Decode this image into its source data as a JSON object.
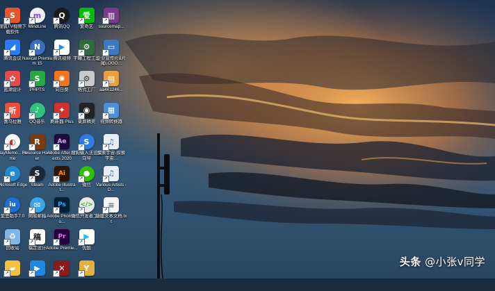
{
  "watermark": {
    "platform": "头条",
    "author": "@小张v同学"
  },
  "desktop_icons": [
    {
      "label": "搜狐TV视频下载软件",
      "icon": "fox-icon",
      "color": "#e8552a",
      "glyph": "S",
      "round": false
    },
    {
      "label": "MindLine",
      "icon": "mindline-icon",
      "color": "#f0f0f0",
      "glyph": "m",
      "round": true,
      "fg": "#8c4bd1"
    },
    {
      "label": "腾讯QQ",
      "icon": "qq-penguin-icon",
      "color": "#1a1a1a",
      "glyph": "Q",
      "round": true
    },
    {
      "label": "爱奇艺",
      "icon": "iqiyi-icon",
      "color": "#00be06",
      "glyph": "爱",
      "round": false
    },
    {
      "label": "sourcemap...",
      "icon": "winrar-icon",
      "color": "#7b3b8c",
      "glyph": "▥",
      "round": false
    },
    {
      "label": "腾讯会议",
      "icon": "tencent-meeting-icon",
      "color": "#2a7cf6",
      "glyph": "◢",
      "round": false
    },
    {
      "label": "Navicat Premium 15",
      "icon": "navicat-icon",
      "color": "#3a6ebf",
      "glyph": "N",
      "round": true
    },
    {
      "label": "腾讯视频",
      "icon": "tencent-video-icon",
      "color": "#ffffff",
      "glyph": "▶",
      "round": false,
      "fg": "#1f8ff0"
    },
    {
      "label": "宇瞳工程工具",
      "icon": "tool-icon",
      "color": "#2f6b3e",
      "glyph": "⚙",
      "round": false
    },
    {
      "label": "企业宣传片&片尾LOGO...",
      "icon": "screen-icon",
      "color": "#3c79c4",
      "glyph": "▭",
      "round": false
    },
    {
      "label": "蓝湖设计",
      "icon": "lanhu-icon",
      "color": "#e84a4a",
      "glyph": "✿",
      "round": false
    },
    {
      "label": "PHPTS",
      "icon": "phpts-icon",
      "color": "#28a745",
      "glyph": "S",
      "round": false
    },
    {
      "label": "向日葵",
      "icon": "sunflower-icon",
      "color": "#f2751c",
      "glyph": "✺",
      "round": false
    },
    {
      "label": "格式工厂",
      "icon": "format-factory-icon",
      "color": "#c9c9c9",
      "glyph": "⚙",
      "round": false,
      "fg": "#333"
    },
    {
      "label": "aa461246...",
      "icon": "image-file-icon",
      "color": "#e8a03a",
      "glyph": "▤",
      "round": false
    },
    {
      "label": "喜马拉雅",
      "icon": "ximalaya-icon",
      "color": "#f34d3a",
      "glyph": "听",
      "round": false
    },
    {
      "label": "QQ音乐",
      "icon": "qq-music-icon",
      "color": "#31c27c",
      "glyph": "♪",
      "round": true
    },
    {
      "label": "刷新器 Plus",
      "icon": "refresh-icon",
      "color": "#d2322d",
      "glyph": "✦",
      "round": false
    },
    {
      "label": "录屏精灵",
      "icon": "record-icon",
      "color": "#222",
      "glyph": "◉",
      "round": false
    },
    {
      "label": "视频转换器",
      "icon": "video-convert-icon",
      "color": "#4a90d9",
      "glyph": "▦",
      "round": false
    },
    {
      "label": "PlayMemo... Home",
      "icon": "playmemories-icon",
      "color": "#ffffff",
      "glyph": "◐",
      "round": true,
      "fg": "#d22"
    },
    {
      "label": "Resource Hacker",
      "icon": "resource-hacker-icon",
      "color": "#7a3b10",
      "glyph": "R",
      "round": false
    },
    {
      "label": "Adobe After Effects 2020",
      "icon": "after-effects-icon",
      "color": "#1f0a3c",
      "glyph": "Ae",
      "round": false,
      "fg": "#d8a5ff"
    },
    {
      "label": "搜狗输入法设置向导",
      "icon": "sogou-icon",
      "color": "#2f7ce0",
      "glyph": "S",
      "round": true
    },
    {
      "label": "探索宇宙-探索宇宙...",
      "icon": "mp3-icon",
      "color": "#e8eef6",
      "glyph": "♫",
      "round": false,
      "fg": "#3a6ebf"
    },
    {
      "label": "Microsoft Edge",
      "icon": "edge-icon",
      "color": "#1e8bd2",
      "glyph": "e",
      "round": true
    },
    {
      "label": "Steam",
      "icon": "steam-icon",
      "color": "#1b2838",
      "glyph": "S",
      "round": true
    },
    {
      "label": "Adobe Illustrat...",
      "icon": "illustrator-icon",
      "color": "#2c1400",
      "glyph": "Ai",
      "round": false,
      "fg": "#ff9a00"
    },
    {
      "label": "微信",
      "icon": "wechat-icon",
      "color": "#2dc100",
      "glyph": "●",
      "round": true
    },
    {
      "label": "Various Artists - D...",
      "icon": "mp3-icon",
      "color": "#e8eef6",
      "glyph": "♫",
      "round": false,
      "fg": "#3a6ebf"
    },
    {
      "label": "爱思助手7.0",
      "icon": "i4-icon",
      "color": "#1d6fd6",
      "glyph": "iu",
      "round": true
    },
    {
      "label": "网易邮箱",
      "icon": "netease-icon",
      "color": "#3aa6e8",
      "glyph": "✉",
      "round": true
    },
    {
      "label": "Adobe Photosho...",
      "icon": "photoshop-icon",
      "color": "#001e36",
      "glyph": "Ps",
      "round": false,
      "fg": "#31a8ff"
    },
    {
      "label": "微信开发者工具",
      "icon": "wechat-dev-icon",
      "color": "#e9e9e9",
      "glyph": "</>",
      "round": true,
      "fg": "#2dc100"
    },
    {
      "label": "新建文本文档.txt",
      "icon": "text-file-icon",
      "color": "#f4f4f4",
      "glyph": "≡",
      "round": false,
      "fg": "#666"
    },
    {
      "label": "回收站",
      "icon": "recycle-bin-icon",
      "color": "#7fb6e6",
      "glyph": "♻",
      "round": false
    },
    {
      "label": "稿定设计",
      "icon": "gaoding-icon",
      "color": "#ffffff",
      "glyph": "稿",
      "round": false,
      "fg": "#222"
    },
    {
      "label": "Adobe Premie...",
      "icon": "premiere-icon",
      "color": "#2a003f",
      "glyph": "Pr",
      "round": false,
      "fg": "#ea77ff"
    },
    {
      "label": "优酷",
      "icon": "youku-icon",
      "color": "#ffffff",
      "glyph": "▶",
      "round": false,
      "fg": "#1ebeff"
    },
    {
      "label": "",
      "icon": "empty-slot",
      "color": "transparent",
      "glyph": "",
      "round": false,
      "hidden": true
    },
    {
      "label": "",
      "icon": "folder-icon",
      "color": "#f0c040",
      "glyph": "▰",
      "round": false
    },
    {
      "label": "",
      "icon": "app-blue-icon",
      "color": "#1e88e5",
      "glyph": "▶",
      "round": false
    },
    {
      "label": "",
      "icon": "game-icon",
      "color": "#8b1a1a",
      "glyph": "✕",
      "round": false
    },
    {
      "label": "",
      "icon": "y-app-icon",
      "color": "#e0b040",
      "glyph": "Y",
      "round": false
    },
    {
      "label": "",
      "icon": "empty-slot",
      "color": "transparent",
      "glyph": "",
      "round": false,
      "hidden": true
    }
  ]
}
